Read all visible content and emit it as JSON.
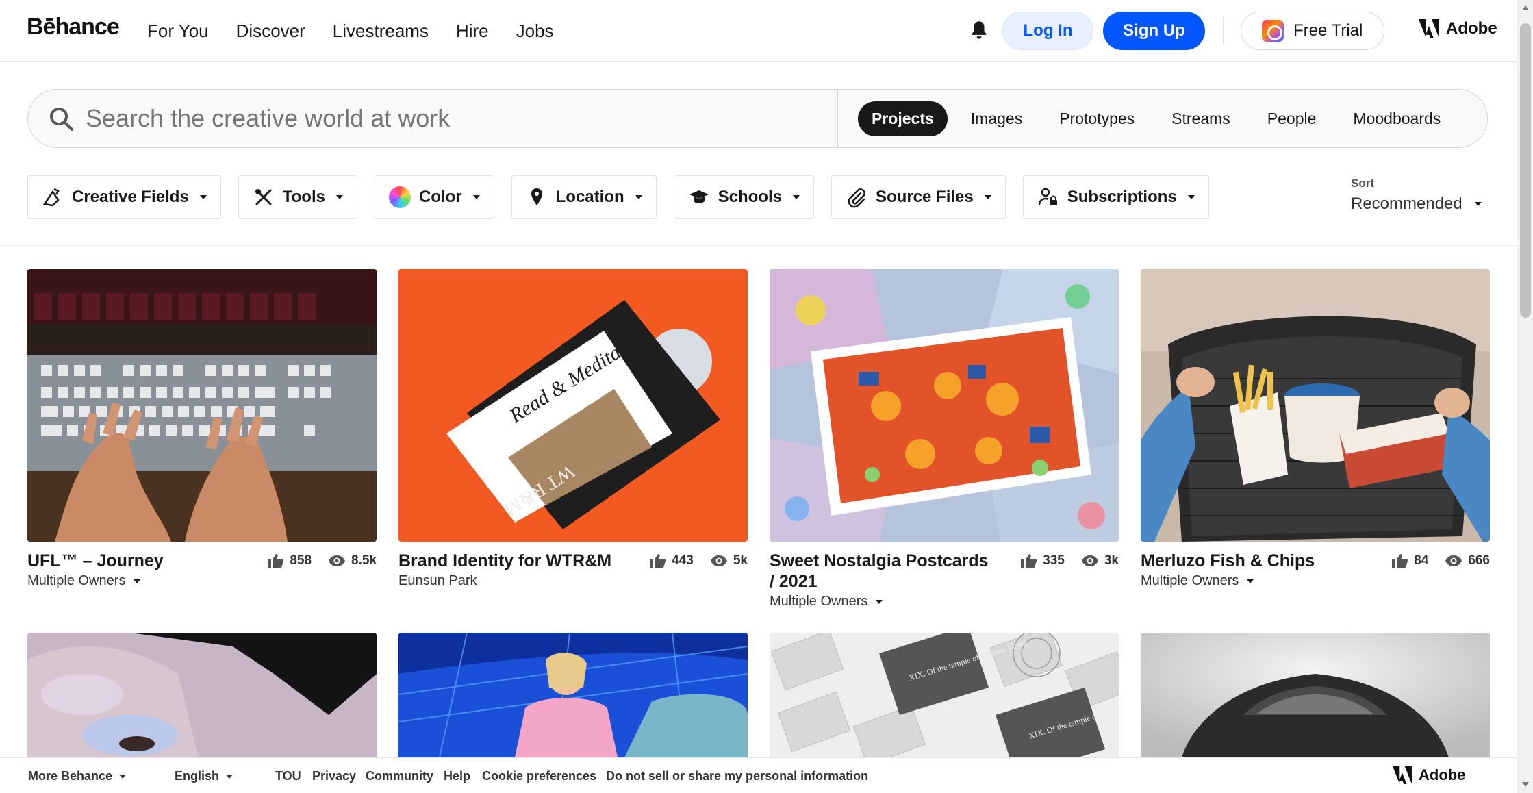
{
  "header": {
    "logo": "Bēhance",
    "nav": [
      "For You",
      "Discover",
      "Livestreams",
      "Hire",
      "Jobs"
    ],
    "login_label": "Log In",
    "signup_label": "Sign Up",
    "trial_label": "Free Trial",
    "adobe_label": "Adobe",
    "accent_color": "#0057ff"
  },
  "search": {
    "placeholder": "Search the creative world at work",
    "scopes": [
      "Projects",
      "Images",
      "Prototypes",
      "Streams",
      "People",
      "Moodboards"
    ],
    "active_scope": "Projects"
  },
  "filters": {
    "items": [
      "Creative Fields",
      "Tools",
      "Color",
      "Location",
      "Schools",
      "Source Files",
      "Subscriptions"
    ],
    "sort_label": "Sort",
    "sort_value": "Recommended"
  },
  "projects": [
    {
      "title": "UFL™ – Journey",
      "owner": "Multiple Owners",
      "owner_dropdown": true,
      "likes": "858",
      "views": "8.5k"
    },
    {
      "title": "Brand Identity for WTR&M",
      "owner": "Eunsun Park",
      "owner_dropdown": false,
      "likes": "443",
      "views": "5k"
    },
    {
      "title": "Sweet Nostalgia Postcards / 2021",
      "owner": "Multiple Owners",
      "owner_dropdown": true,
      "likes": "335",
      "views": "3k"
    },
    {
      "title": "Merluzo Fish & Chips",
      "owner": "Multiple Owners",
      "owner_dropdown": true,
      "likes": "84",
      "views": "666"
    }
  ],
  "thumb_text": {
    "card2_card": "Read & Meditate",
    "card2_mark": "WT R&M",
    "card8_panel1": "XIX. Of the temple of Fortuna Virilis",
    "card8_panel2": "XIX. Of the temple of Jupiter the Thunderer"
  },
  "footer": {
    "more": "More Behance",
    "language": "English",
    "links": [
      "TOU",
      "Privacy",
      "Community",
      "Help",
      "Cookie preferences",
      "Do not sell or share my personal information"
    ],
    "adobe_label": "Adobe"
  }
}
